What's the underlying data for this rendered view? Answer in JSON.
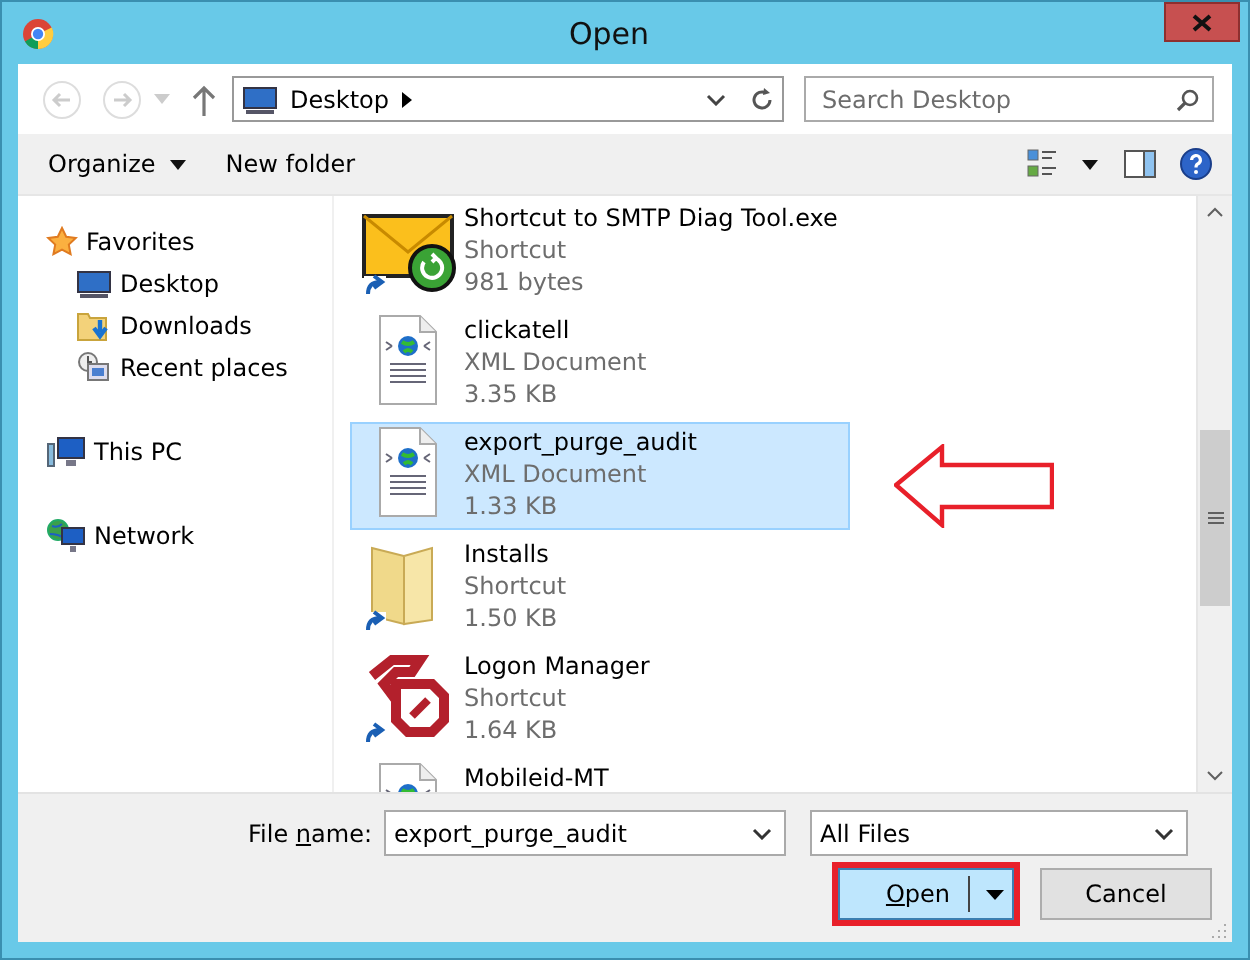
{
  "window": {
    "title": "Open"
  },
  "address": {
    "location": "Desktop"
  },
  "search": {
    "placeholder": "Search Desktop"
  },
  "toolbar": {
    "organize": "Organize",
    "new_folder": "New folder"
  },
  "sidebar": {
    "items": [
      {
        "label": "Favorites",
        "kind": "favorites",
        "children": [
          {
            "label": "Desktop",
            "kind": "desktop"
          },
          {
            "label": "Downloads",
            "kind": "downloads"
          },
          {
            "label": "Recent places",
            "kind": "recent"
          }
        ]
      },
      {
        "label": "This PC",
        "kind": "pc"
      },
      {
        "label": "Network",
        "kind": "network"
      }
    ]
  },
  "files": [
    {
      "name": "Shortcut to SMTP Diag Tool.exe",
      "type": "Shortcut",
      "size": "981 bytes",
      "kind": "mail-shortcut",
      "selected": false
    },
    {
      "name": "clickatell",
      "type": "XML Document",
      "size": "3.35 KB",
      "kind": "xml",
      "selected": false
    },
    {
      "name": "export_purge_audit",
      "type": "XML Document",
      "size": "1.33 KB",
      "kind": "xml",
      "selected": true
    },
    {
      "name": "Installs",
      "type": "Shortcut",
      "size": "1.50 KB",
      "kind": "folder-shortcut",
      "selected": false
    },
    {
      "name": "Logon Manager",
      "type": "Shortcut",
      "size": "1.64 KB",
      "kind": "logon-shortcut",
      "selected": false
    },
    {
      "name": "Mobileid-MT",
      "kind": "xml",
      "selected": false
    }
  ],
  "file_name": {
    "label": {
      "before": "File ",
      "access_key": "n",
      "after": "ame:"
    },
    "value": "export_purge_audit"
  },
  "file_type": {
    "value": "All Files"
  },
  "buttons": [
    {
      "label": {
        "access_key": "O",
        "after": "pen"
      },
      "kind": "split"
    },
    {
      "label": "Cancel",
      "kind": "plain"
    }
  ]
}
